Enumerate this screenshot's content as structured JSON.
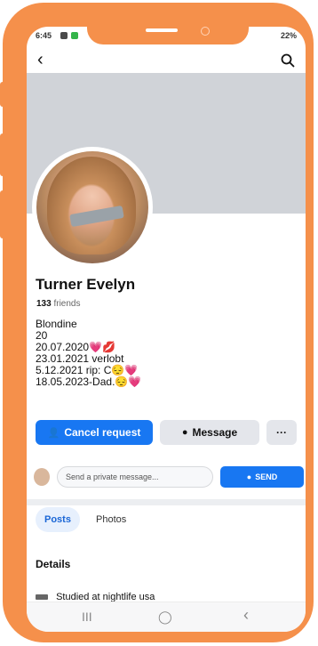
{
  "status_bar": {
    "time": "6:45",
    "right": "22%"
  },
  "header": {
    "back_icon": "chevron-left",
    "search_icon": "search"
  },
  "profile": {
    "name": "Turner Evelyn",
    "friends_count": "133",
    "friends_label": "friends",
    "bio": [
      "Blondine",
      "20",
      "20.07.2020💗💋",
      "23.01.2021 verlobt",
      "5.12.2021 rip: C😔💗",
      "18.05.2023-Dad.😔💗"
    ]
  },
  "actions": {
    "cancel_request": "Cancel request",
    "message": "Message",
    "more": "···"
  },
  "private_message": {
    "placeholder": "Send a private message...",
    "send": "SEND"
  },
  "tabs": [
    "Posts",
    "Photos"
  ],
  "details": {
    "title": "Details",
    "studied": "Studied at nightlife usa"
  },
  "nav": {
    "recent": "III",
    "home": "◯",
    "back": "‹"
  },
  "colors": {
    "frame": "#f5904b",
    "accent": "#1877f2"
  }
}
